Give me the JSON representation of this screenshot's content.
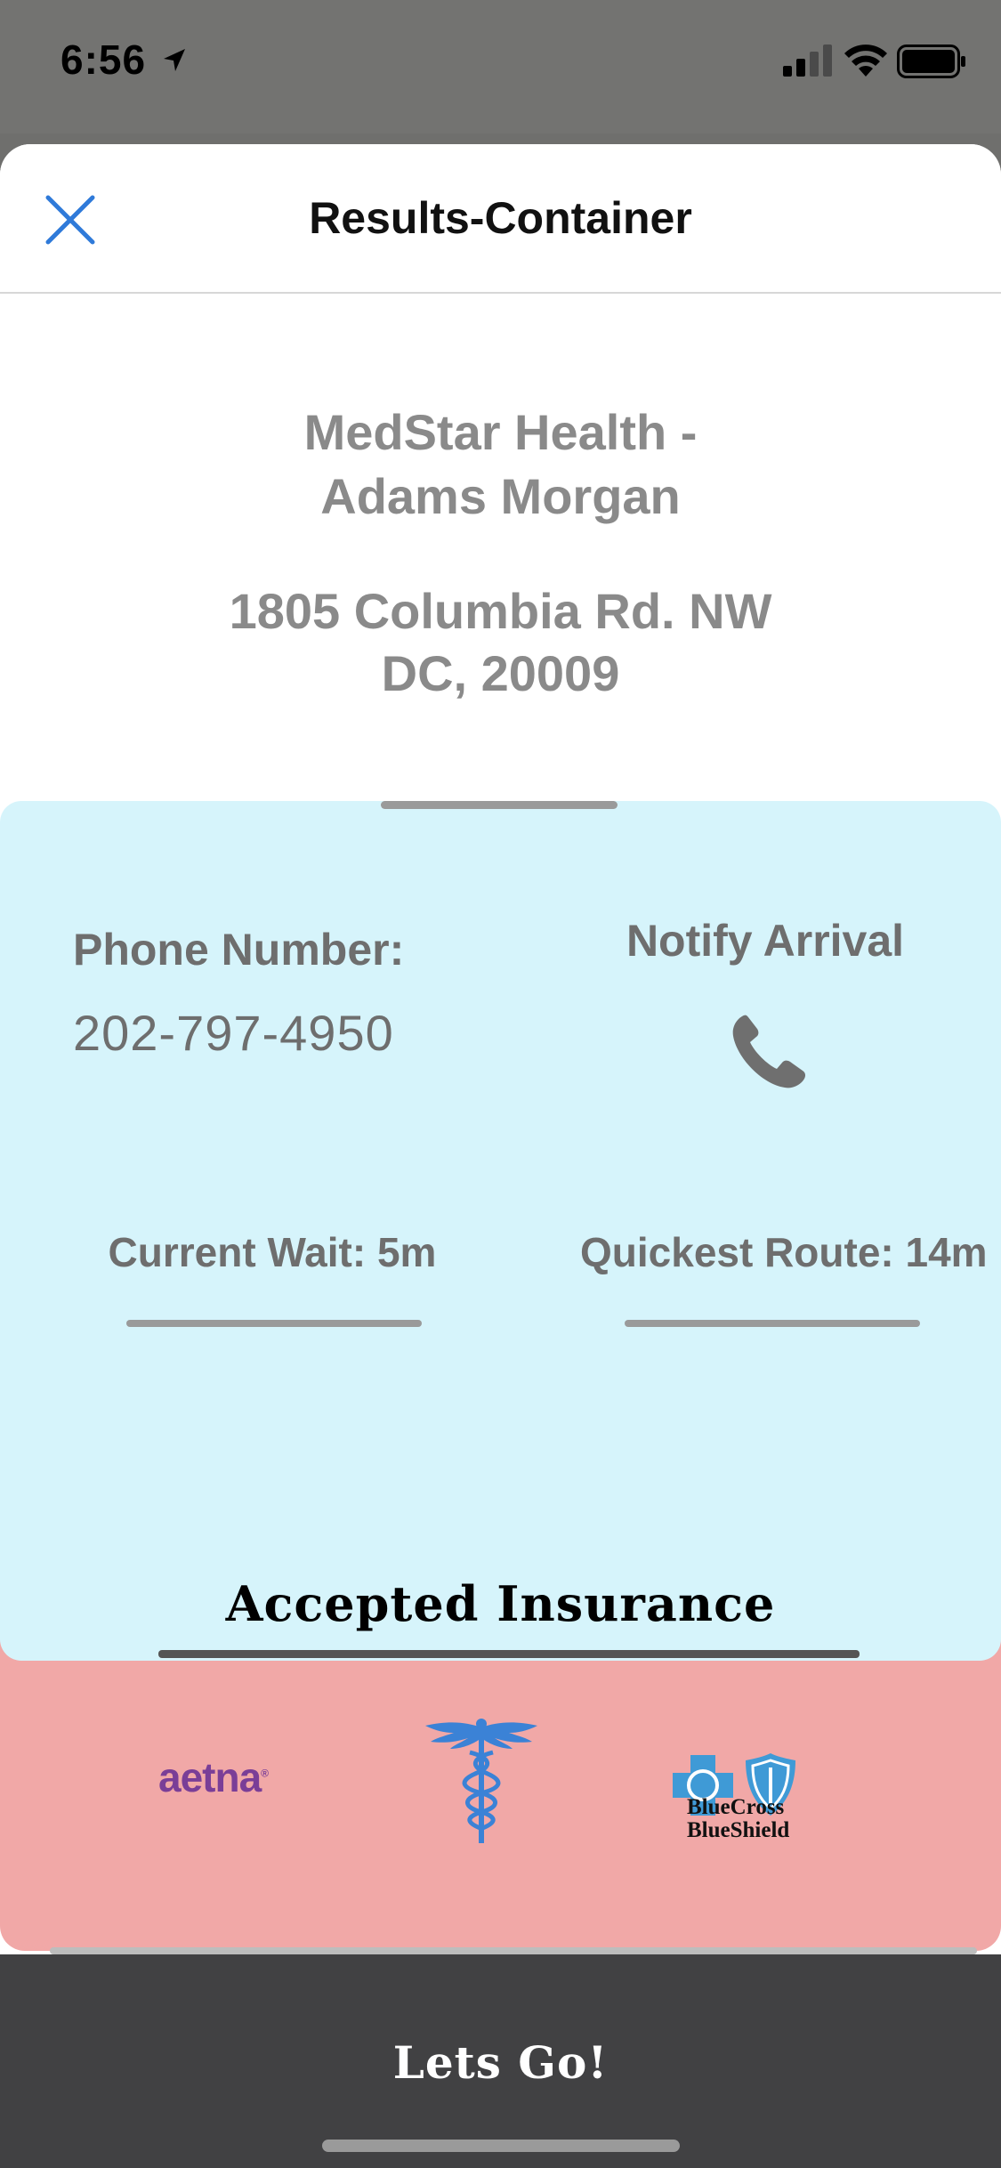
{
  "status_bar": {
    "time": "6:56"
  },
  "nav": {
    "title": "Results-Container"
  },
  "facility": {
    "name": "MedStar Health -\nAdams Morgan",
    "address": "1805 Columbia Rd. NW\nDC, 20009"
  },
  "info": {
    "phone_label": "Phone Number:",
    "phone_value": "202-797-4950",
    "notify_label": "Notify Arrival",
    "current_wait": "Current Wait: 5m",
    "quickest_route": "Quickest Route: 14m"
  },
  "insurance": {
    "title": "Accepted Insurance",
    "providers": [
      {
        "name": "aetna",
        "icon": "aetna-logo"
      },
      {
        "icon": "caduceus-icon"
      },
      {
        "name_line1": "BlueCross",
        "name_line2": "BlueShield",
        "icon": "bcbs-logo"
      }
    ]
  },
  "actions": {
    "primary": "Lets Go!"
  },
  "colors": {
    "sheet": "#ffffff",
    "info_panel": "#d6f4fb",
    "insurance_panel": "#f1a8a7",
    "bottom_bar": "#414143",
    "accent_blue": "#2f7ad9",
    "aetna_purple": "#7a3e97",
    "bcbs_blue": "#3f9ad6"
  }
}
